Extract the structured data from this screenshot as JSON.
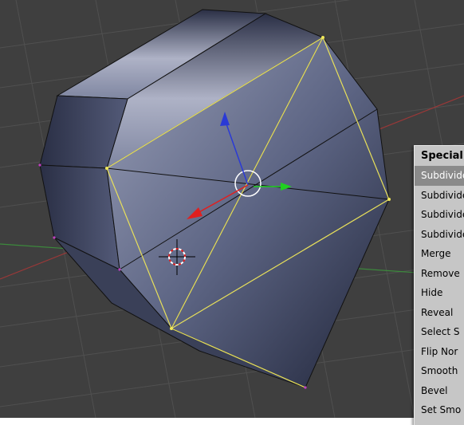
{
  "menu": {
    "title": "Special",
    "items": [
      {
        "label": "Subdivide",
        "active": true
      },
      {
        "label": "Subdivide"
      },
      {
        "label": "Subdivide"
      },
      {
        "label": "Subdivide"
      },
      {
        "label": "Merge"
      },
      {
        "label": "Remove"
      },
      {
        "label": "Hide"
      },
      {
        "label": "Reveal"
      },
      {
        "label": "Select S"
      },
      {
        "label": "Flip Nor"
      },
      {
        "label": "Smooth"
      },
      {
        "label": "Bevel"
      },
      {
        "label": "Set Smo"
      }
    ]
  },
  "colors": {
    "viewport_bg": "#3f3f3f",
    "grid": "#505050",
    "x_axis": "#9b3838",
    "y_axis": "#3c8a3c",
    "mesh_edge": "#111111",
    "selected_edge": "#e8e05a",
    "widget_x": "#e02020",
    "widget_y": "#20d020",
    "widget_z": "#2a3ad6"
  },
  "icons": [
    "3d-cursor-icon",
    "transform-widget-icon"
  ]
}
